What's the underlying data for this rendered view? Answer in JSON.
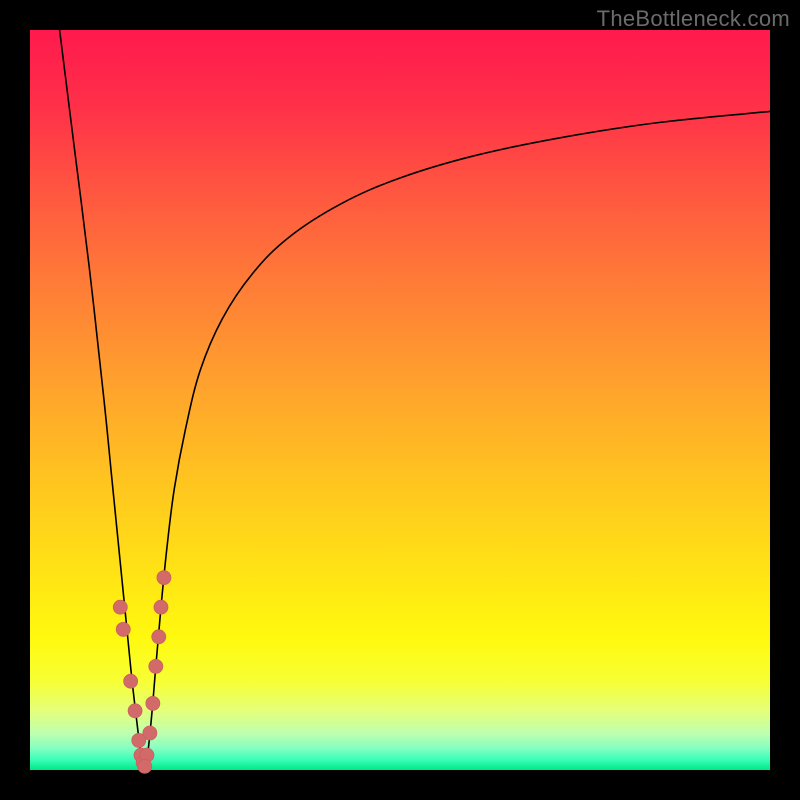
{
  "watermark": "TheBottleneck.com",
  "colors": {
    "background": "#000000",
    "curve": "#000000",
    "dot": "#d36a6a",
    "gradient_top": "#ff1a4d",
    "gradient_bottom": "#00e887"
  },
  "chart_data": {
    "type": "line",
    "title": "",
    "xlabel": "",
    "ylabel": "",
    "xlim": [
      0,
      100
    ],
    "ylim": [
      0,
      100
    ],
    "series": [
      {
        "name": "curve-left",
        "x": [
          4,
          6,
          8,
          10,
          11,
          12,
          13,
          13.8,
          14.5,
          15,
          15.5
        ],
        "values": [
          100,
          84,
          68,
          50,
          40,
          30,
          20,
          12,
          6,
          2,
          0
        ]
      },
      {
        "name": "curve-right",
        "x": [
          15.5,
          16,
          16.5,
          17,
          17.7,
          18.5,
          19.5,
          21,
          23,
          26,
          30,
          35,
          42,
          50,
          60,
          72,
          85,
          100
        ],
        "values": [
          0,
          3,
          8,
          14,
          22,
          30,
          38,
          46,
          54,
          61,
          67,
          72,
          76.5,
          80,
          83,
          85.5,
          87.5,
          89
        ]
      }
    ],
    "markers": [
      {
        "name": "left-dot-1",
        "x": 12.2,
        "y": 22
      },
      {
        "name": "left-dot-2",
        "x": 12.6,
        "y": 19
      },
      {
        "name": "left-dot-3",
        "x": 13.6,
        "y": 12
      },
      {
        "name": "left-dot-4",
        "x": 14.2,
        "y": 8
      },
      {
        "name": "left-dot-5",
        "x": 14.7,
        "y": 4
      },
      {
        "name": "left-dot-6",
        "x": 15.0,
        "y": 2
      },
      {
        "name": "left-dot-7",
        "x": 15.3,
        "y": 1
      },
      {
        "name": "right-cap-1",
        "x": 17.0,
        "y": 14
      },
      {
        "name": "right-cap-2",
        "x": 17.4,
        "y": 18
      },
      {
        "name": "right-cap-3",
        "x": 17.7,
        "y": 22
      },
      {
        "name": "right-cap-4",
        "x": 18.1,
        "y": 26
      },
      {
        "name": "right-cap-5",
        "x": 16.6,
        "y": 9
      },
      {
        "name": "right-cap-6",
        "x": 16.2,
        "y": 5
      },
      {
        "name": "right-cap-7",
        "x": 15.8,
        "y": 2
      },
      {
        "name": "right-cap-8",
        "x": 15.5,
        "y": 0.5
      }
    ]
  }
}
